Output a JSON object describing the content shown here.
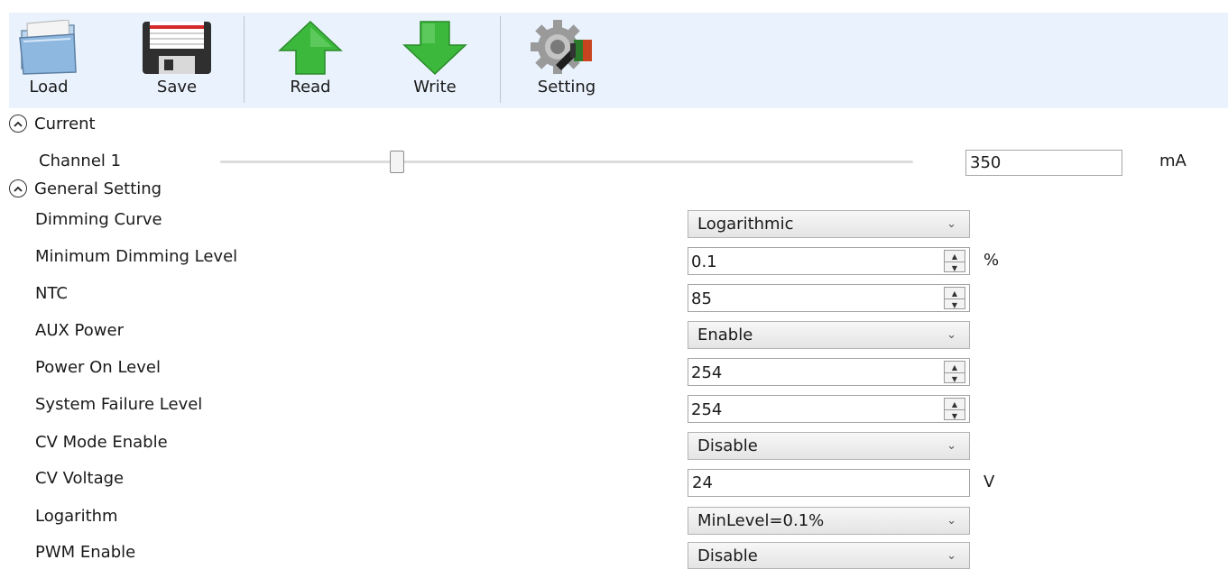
{
  "toolbar": {
    "load_label": "Load",
    "save_label": "Save",
    "read_label": "Read",
    "write_label": "Write",
    "setting_label": "Setting"
  },
  "current": {
    "header": "Current",
    "channel_label": "Channel 1",
    "channel_value": "350",
    "unit": "mA",
    "slider_fraction": 0.255
  },
  "general": {
    "header": "General Setting",
    "rows": [
      {
        "label": "Dimming Curve",
        "type": "select",
        "value": "Logarithmic"
      },
      {
        "label": "Minimum Dimming Level",
        "type": "spin",
        "value": "0.1",
        "unit": "%"
      },
      {
        "label": "NTC",
        "type": "spin",
        "value": "85"
      },
      {
        "label": "AUX Power",
        "type": "select",
        "value": "Enable"
      },
      {
        "label": "Power On Level",
        "type": "spin",
        "value": "254"
      },
      {
        "label": "System Failure Level",
        "type": "spin",
        "value": "254"
      },
      {
        "label": "CV Mode Enable",
        "type": "select",
        "value": "Disable"
      },
      {
        "label": "CV Voltage",
        "type": "text",
        "value": "24",
        "unit": "V"
      },
      {
        "label": "Logarithm",
        "type": "select",
        "value": "MinLevel=0.1%"
      },
      {
        "label": "PWM Enable",
        "type": "select",
        "value": "Disable"
      }
    ]
  },
  "icons": {
    "load": "folder-icon",
    "save": "floppy-disk-icon",
    "read": "up-arrow-icon",
    "write": "down-arrow-icon",
    "setting": "gear-icon",
    "collapse": "chevron-up-icon",
    "dropdown": "chevron-down-icon"
  },
  "colors": {
    "toolbar_bg": "#eaf3fd",
    "arrow_green": "#3cb83c",
    "floppy_red": "#d42a2a"
  }
}
